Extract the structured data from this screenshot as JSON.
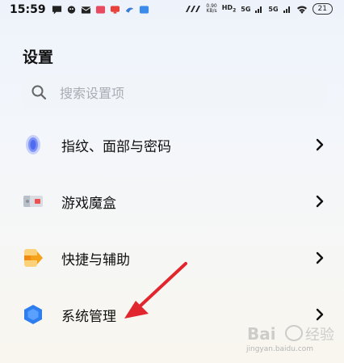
{
  "status_bar": {
    "time": "15:59",
    "net_speed_value": "0.90",
    "net_speed_unit": "KB/s",
    "hd_label": "HD",
    "hd_sub": "2",
    "signal_1": "5G",
    "signal_2": "5G",
    "battery": "21"
  },
  "page": {
    "title": "设置"
  },
  "search": {
    "placeholder": "搜索设置项"
  },
  "items": [
    {
      "label": "指纹、面部与密码",
      "icon": "fingerprint-icon"
    },
    {
      "label": "游戏魔盒",
      "icon": "game-box-icon"
    },
    {
      "label": "快捷与辅助",
      "icon": "shortcut-icon"
    },
    {
      "label": "系统管理",
      "icon": "system-management-icon"
    }
  ],
  "watermark": {
    "url": "jingyan.baidu.com"
  },
  "colors": {
    "accent_red": "#e2262d",
    "fingerprint_blue": "#4f6bf0",
    "shortcut_orange": "#f4a21c",
    "system_blue": "#2f7ef0"
  }
}
